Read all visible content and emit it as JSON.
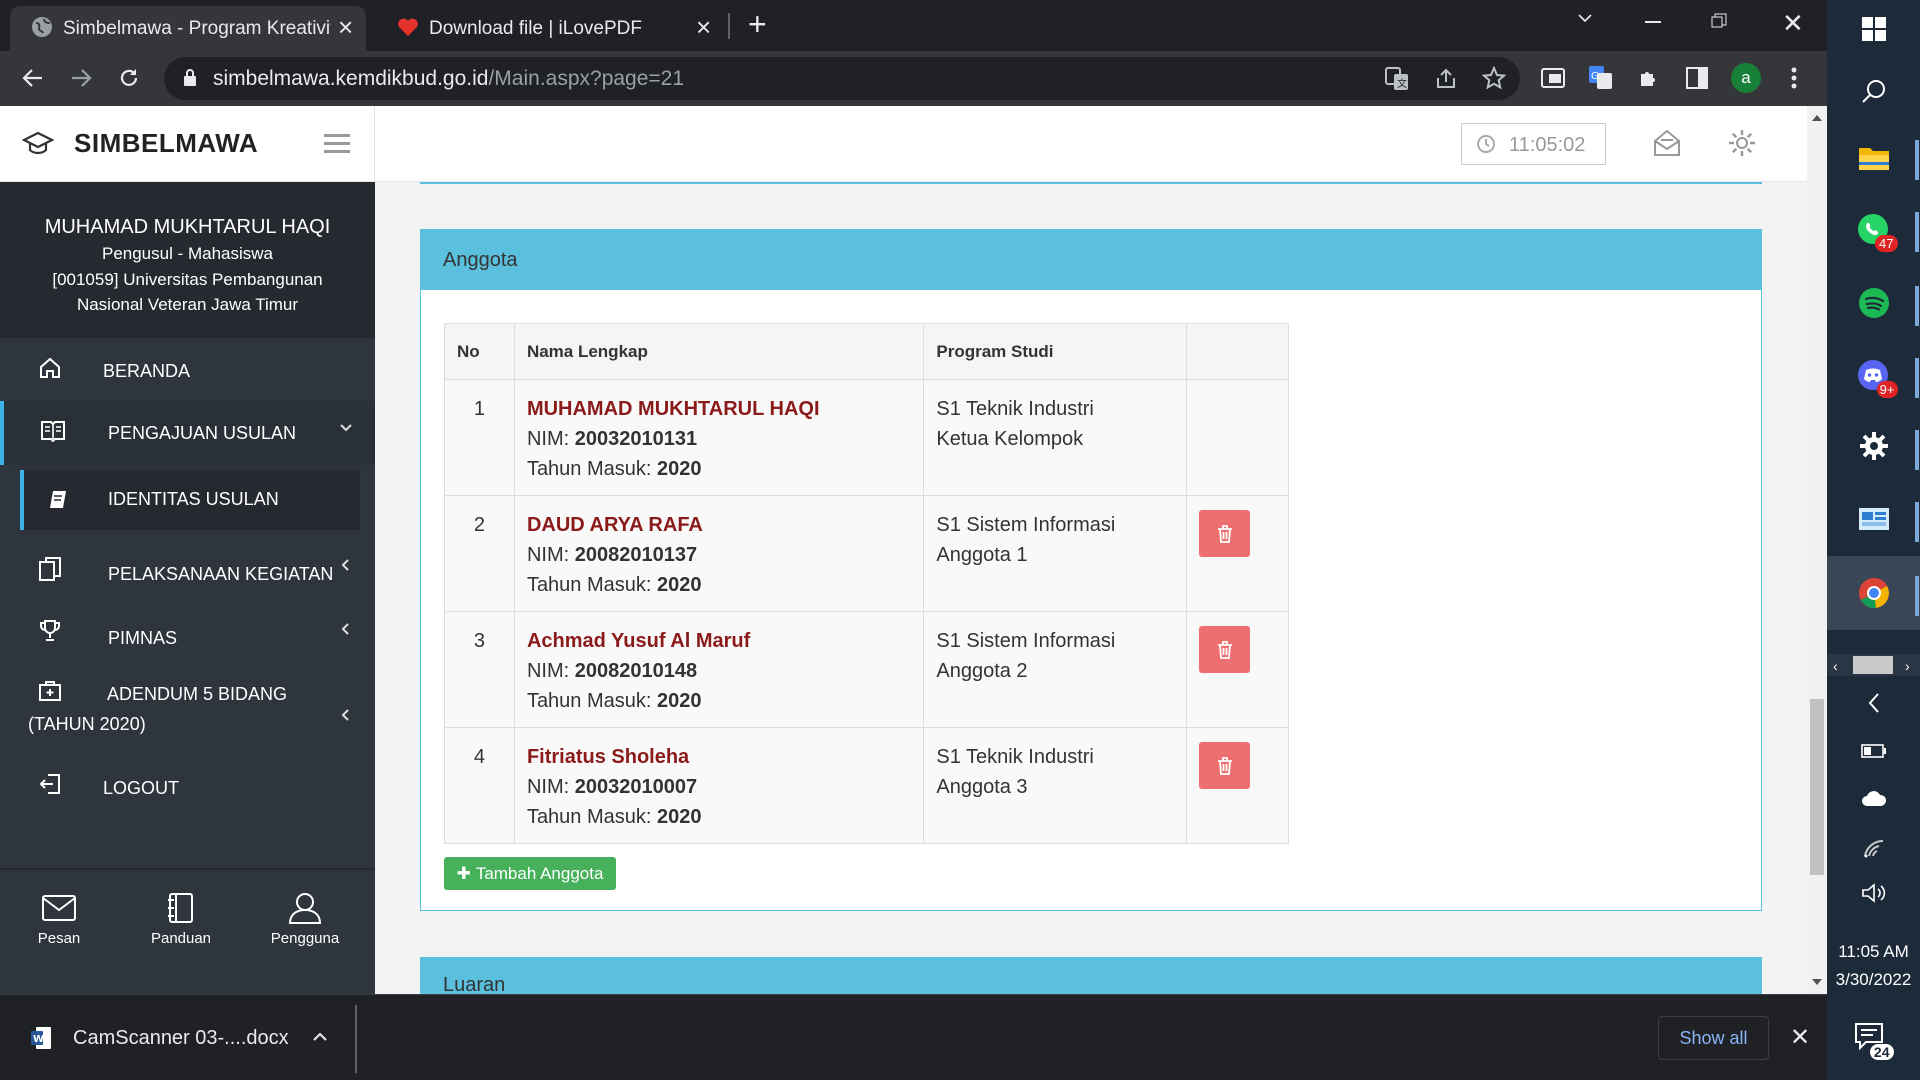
{
  "browser": {
    "tabs": [
      {
        "title": "Simbelmawa - Program Kreativita",
        "active": true
      },
      {
        "title": "Download file | iLovePDF",
        "active": false
      }
    ],
    "url_host": "simbelmawa.kemdikbud.go.id",
    "url_path": "/Main.aspx?page=21",
    "profile_initial": "a"
  },
  "header": {
    "brand": "SIMBELMAWA",
    "clock": "11:05:02"
  },
  "profile": {
    "name": "MUHAMAD MUKHTARUL HAQI",
    "role": "Pengusul - Mahasiswa",
    "institution_line1": "[001059] Universitas Pembangunan",
    "institution_line2": "Nasional Veteran Jawa Timur"
  },
  "nav": {
    "beranda": "BERANDA",
    "pengajuan": "PENGAJUAN USULAN",
    "identitas": "IDENTITAS USULAN",
    "pelaksanaan": "PELAKSANAAN KEGIATAN",
    "pimnas": "PIMNAS",
    "adendum_line1": "ADENDUM 5 BIDANG",
    "adendum_line2": "(TAHUN 2020)",
    "logout": "LOGOUT"
  },
  "footer_nav": {
    "pesan": "Pesan",
    "panduan": "Panduan",
    "pengguna": "Pengguna"
  },
  "anggota": {
    "title": "Anggota",
    "headers": {
      "no": "No",
      "nama": "Nama Lengkap",
      "prodi": "Program Studi"
    },
    "nim_label": "NIM: ",
    "tahun_label": "Tahun Masuk: ",
    "rows": [
      {
        "no": "1",
        "name": "MUHAMAD MUKHTARUL HAQI",
        "nim": "20032010131",
        "tahun": "2020",
        "prodi": "S1 Teknik Industri",
        "role": "Ketua Kelompok",
        "deletable": false
      },
      {
        "no": "2",
        "name": "DAUD ARYA RAFA",
        "nim": "20082010137",
        "tahun": "2020",
        "prodi": "S1 Sistem Informasi",
        "role": "Anggota 1",
        "deletable": true
      },
      {
        "no": "3",
        "name": "Achmad Yusuf Al Maruf",
        "nim": "20082010148",
        "tahun": "2020",
        "prodi": "S1 Sistem Informasi",
        "role": "Anggota 2",
        "deletable": true
      },
      {
        "no": "4",
        "name": "Fitriatus Sholeha",
        "nim": "20032010007",
        "tahun": "2020",
        "prodi": "S1 Teknik Industri",
        "role": "Anggota 3",
        "deletable": true
      }
    ],
    "add_button": "Tambah Anggota"
  },
  "luaran": {
    "title": "Luaran"
  },
  "downloads": {
    "file": "CamScanner 03-....docx",
    "show_all": "Show all"
  },
  "taskbar": {
    "whatsapp_badge": "47",
    "discord_badge": "9+",
    "time": "11:05 AM",
    "date": "3/30/2022",
    "notification_count": "24"
  },
  "colors": {
    "panel_info": "#5bc0de",
    "member_name": "#8b1a1a",
    "delete_button": "#ee6f6f",
    "add_button": "#47b05a",
    "sidebar": "#2f353d",
    "active_accent": "#3bb4e5"
  }
}
